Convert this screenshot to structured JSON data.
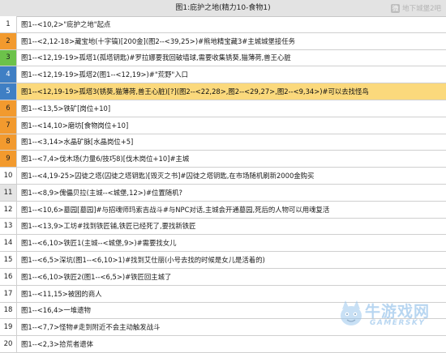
{
  "table": {
    "title": "图1:庇护之地(精力10-食物1)"
  },
  "watermark_top": {
    "icon": "weibo-icon",
    "label": "地下城堡2吧"
  },
  "watermark_bottom": {
    "brand_cn": "牛游戏网",
    "brand_en": "GAMERSKY"
  },
  "index_colors": {
    "orange": "#f29a2e",
    "green": "#6cc24a",
    "blue": "#3f7fc4",
    "gray": "#e4e4e4",
    "highlight": "#fbd97c"
  },
  "rows": [
    {
      "n": "1",
      "text": "图1--<10,2>\"庇护之地\"起点",
      "marker": "white",
      "highlight": false
    },
    {
      "n": "2",
      "text": "图1--<2,12-18>藏宝地(十字镐)[200金](图2--<39,25>)#熊地精宝藏3#主城城堡接任务",
      "marker": "orange",
      "highlight": false
    },
    {
      "n": "3",
      "text": "图1--<12,19-19>孤塔1(孤塔钥匙)#罗拉娜要我回破墙球,需要收集锈葵,猫薄荷,兽王心脏",
      "marker": "green",
      "highlight": false
    },
    {
      "n": "4",
      "text": "图1--<12,19-19>孤塔2(图1--<12,19>)#\"荒野\"入口",
      "marker": "blue",
      "highlight": false
    },
    {
      "n": "5",
      "text": "图1--<12,19-19>孤塔3(锈葵,猫薄荷,兽王心脏)[?](图2--<22,28>,图2--<29,27>,图2--<9,34>)#可以去找怪鸟",
      "marker": "blue",
      "highlight": true
    },
    {
      "n": "6",
      "text": "图1--<13,5>铁矿[岗位+10]",
      "marker": "orange",
      "highlight": false
    },
    {
      "n": "7",
      "text": "图1--<14,10>磨坊[食物岗位+10]",
      "marker": "orange",
      "highlight": false
    },
    {
      "n": "8",
      "text": "图1--<3,14>水晶矿脉[水晶岗位+5]",
      "marker": "orange",
      "highlight": false
    },
    {
      "n": "9",
      "text": "图1--<7,4>伐木场(力量6/技巧8)[伐木岗位+10]#主城",
      "marker": "orange",
      "highlight": false
    },
    {
      "n": "10",
      "text": "图1--<4,19-25>囚徒之塔(囚徒之塔钥匙)[毁灭之书]#囚徒之塔钥匙,在市场随机刷新2000金购买",
      "marker": "white",
      "highlight": false
    },
    {
      "n": "11",
      "text": "图1--<8,9>傀儡贝拉(主城--<城堡,12>)#位置随机?",
      "marker": "gray",
      "highlight": false
    },
    {
      "n": "12",
      "text": "图1--<10,6>墓园[墓园]#与招魂师玛索吉战斗#与NPC对话,主城会开通墓园,死后的人物可以用魂复活",
      "marker": "white",
      "highlight": false
    },
    {
      "n": "13",
      "text": "图1--<13,9>工坊#找到铁匠铺,铁匠已经死了,要找新铁匠",
      "marker": "white",
      "highlight": false
    },
    {
      "n": "14",
      "text": "图1--<6,10>铁匠1(主城--<城堡,9>)#需要找女儿",
      "marker": "white",
      "highlight": false
    },
    {
      "n": "15",
      "text": "图1--<6,5>深坑(图1--<6,10>1)#找到艾仕丽(小号去找的时候是女儿是活着的)",
      "marker": "white",
      "highlight": false
    },
    {
      "n": "16",
      "text": "图1--<6,10>铁匠2(图1--<6,5>)#铁匠回主城了",
      "marker": "white",
      "highlight": false
    },
    {
      "n": "17",
      "text": "图1--<11,15>被困的商人",
      "marker": "white",
      "highlight": false
    },
    {
      "n": "18",
      "text": "图1--<16,4>一堆遗物",
      "marker": "white",
      "highlight": false
    },
    {
      "n": "19",
      "text": "图1--<7,7>怪物#走到附近不会主动触发战斗",
      "marker": "white",
      "highlight": false
    },
    {
      "n": "20",
      "text": "图1--<2,3>拾荒者遗体",
      "marker": "white",
      "highlight": false
    }
  ]
}
